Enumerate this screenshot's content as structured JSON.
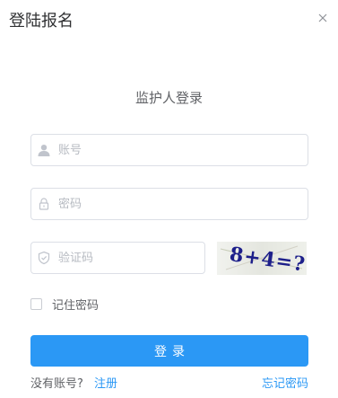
{
  "dialog": {
    "title": "登陆报名",
    "close_icon": "close-icon"
  },
  "form": {
    "title": "监护人登录",
    "account": {
      "placeholder": "账号",
      "icon": "user-icon"
    },
    "password": {
      "placeholder": "密码",
      "icon": "lock-icon"
    },
    "captcha": {
      "placeholder": "验证码",
      "icon": "shield-check-icon",
      "image_text": "8+4=?"
    },
    "remember_label": "记住密码",
    "login_label": "登录",
    "no_account_text": "没有账号?",
    "register_label": "注册",
    "forgot_label": "忘记密码"
  },
  "colors": {
    "primary": "#2b98f5",
    "border": "#dcdfe6",
    "text": "#606266",
    "placeholder": "#b7bbc2"
  }
}
